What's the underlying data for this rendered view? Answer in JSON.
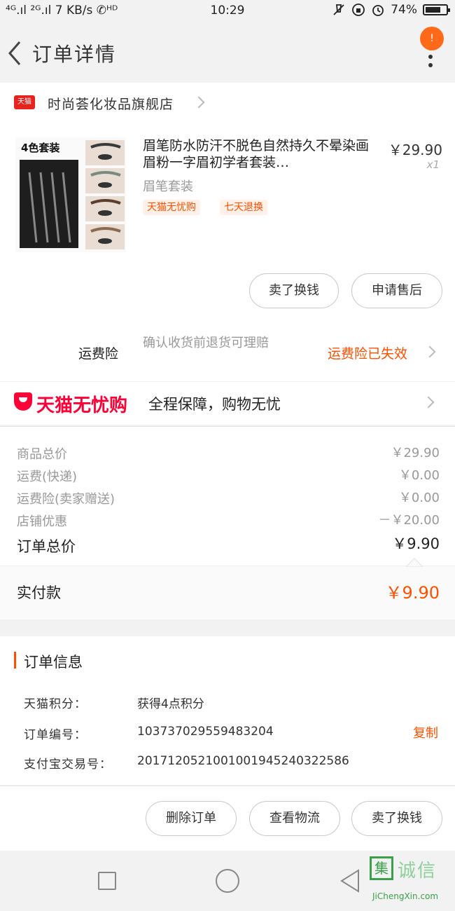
{
  "status_bar": {
    "left": "⁴ᴳ.ıl ²ᴳ.ıl 7 KB/s ✆ᴴᴰ",
    "time": "10:29",
    "battery": "74%",
    "battery_level": 0.74
  },
  "header": {
    "title": "订单详情",
    "notification_count": "!"
  },
  "shop": {
    "logo_text": "天猫",
    "name": "时尚荟化妆品旗舰店"
  },
  "product": {
    "image_caption": "4色套装",
    "title": "眉笔防水防汗不脱色自然持久不晕染画眉粉一字眉初学者套装…",
    "sku": "眉笔套装",
    "price": "￥29.90",
    "qty": "x1",
    "tags": [
      "天猫无忧购",
      "七天退换"
    ]
  },
  "actions": {
    "sell_label": "卖了换钱",
    "after_sale_label": "申请售后"
  },
  "insurance": {
    "label": "运费险",
    "desc": "确认收货前退货可理赔",
    "status": "运费险已失效"
  },
  "guarantee": {
    "brand": "天猫无忧购",
    "text": "全程保障，购物无忧"
  },
  "price_rows": [
    {
      "label": "商品总价",
      "value": "￥29.90"
    },
    {
      "label": "运费(快递)",
      "value": "￥0.00"
    },
    {
      "label": "运费险(卖家赠送)",
      "value": "￥0.00"
    },
    {
      "label": "店铺优惠",
      "value": "－￥20.00"
    }
  ],
  "order_total": {
    "label": "订单总价",
    "value": "￥9.90"
  },
  "paid": {
    "label": "实付款",
    "value": "￥9.90"
  },
  "order_info": {
    "title": "订单信息",
    "rows": [
      {
        "key": "天猫积分：",
        "value": "获得4点积分"
      },
      {
        "key": "订单编号：",
        "value": "103737029559483204"
      },
      {
        "key": "支付宝交易号：",
        "value": "2017120521001001945240322586"
      }
    ],
    "copy_label": "复制"
  },
  "bottom_actions": {
    "delete_label": "删除订单",
    "logistics_label": "查看物流",
    "sell_label": "卖了换钱"
  },
  "watermark": {
    "mark": "集",
    "cn": "诚信",
    "en": "JiChengXin.com"
  }
}
